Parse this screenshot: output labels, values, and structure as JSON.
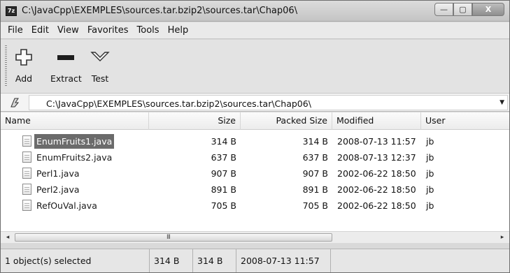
{
  "window": {
    "title": "C:\\JavaCpp\\EXEMPLES\\sources.tar.bzip2\\sources.tar\\Chap06\\",
    "app_icon_text": "7z",
    "minimize_symbol": "—",
    "maximize_symbol": "▢",
    "close_symbol": "X"
  },
  "menu": {
    "items": [
      "File",
      "Edit",
      "View",
      "Favorites",
      "Tools",
      "Help"
    ]
  },
  "toolbar": {
    "add_label": "Add",
    "extract_label": "Extract",
    "test_label": "Test"
  },
  "address": {
    "path": "C:\\JavaCpp\\EXEMPLES\\sources.tar.bzip2\\sources.tar\\Chap06\\",
    "dropdown_symbol": "▼"
  },
  "columns": {
    "name": "Name",
    "size": "Size",
    "packed": "Packed Size",
    "modified": "Modified",
    "user": "User"
  },
  "files": [
    {
      "name": "EnumFruits1.java",
      "size": "314 B",
      "packed": "314 B",
      "modified": "2008-07-13 11:57",
      "user": "jb",
      "selected": true
    },
    {
      "name": "EnumFruits2.java",
      "size": "637 B",
      "packed": "637 B",
      "modified": "2008-07-13 12:37",
      "user": "jb",
      "selected": false
    },
    {
      "name": "Perl1.java",
      "size": "907 B",
      "packed": "907 B",
      "modified": "2002-06-22 18:50",
      "user": "jb",
      "selected": false
    },
    {
      "name": "Perl2.java",
      "size": "891 B",
      "packed": "891 B",
      "modified": "2002-06-22 18:50",
      "user": "jb",
      "selected": false
    },
    {
      "name": "RefOuVal.java",
      "size": "705 B",
      "packed": "705 B",
      "modified": "2002-06-22 18:50",
      "user": "jb",
      "selected": false
    }
  ],
  "scrollbar": {
    "left_symbol": "◂",
    "right_symbol": "▸",
    "grip_symbol": "III"
  },
  "status": {
    "selection": "1 object(s) selected",
    "size": "314 B",
    "packed": "314 B",
    "modified": "2008-07-13 11:57"
  },
  "colors": {
    "selection": "#6b6b6b",
    "window_bg": "#d9d9d9"
  }
}
